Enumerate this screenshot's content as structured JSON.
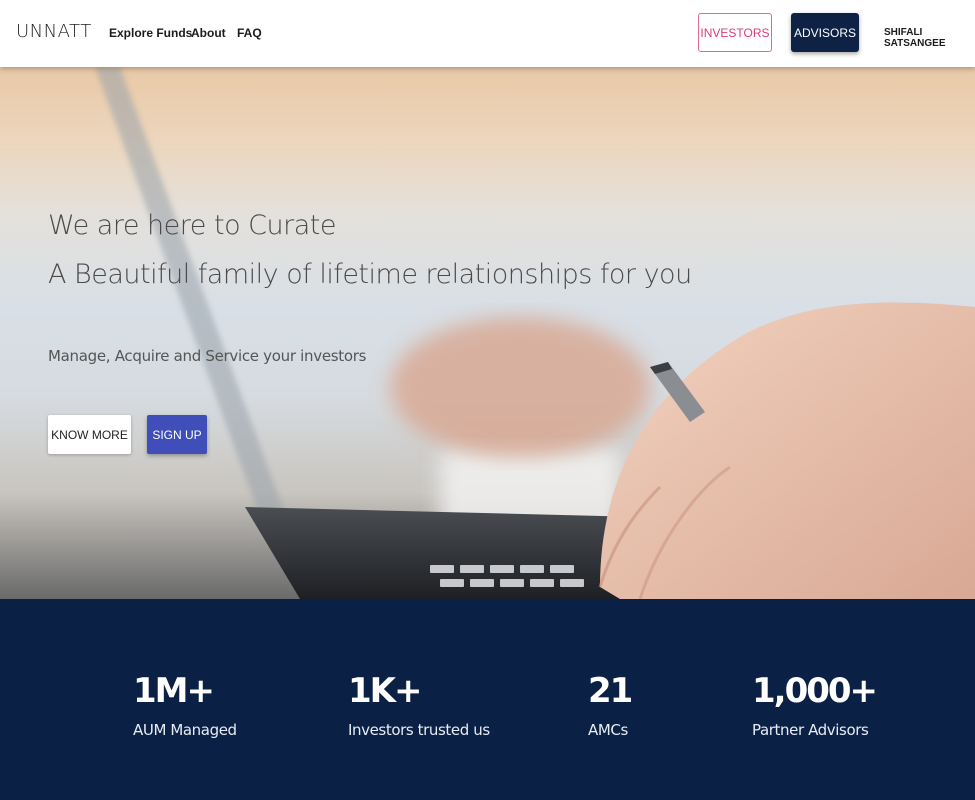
{
  "header": {
    "brand": "UNNATT",
    "nav": {
      "explore": "Explore Funds",
      "about": "About",
      "faq": "FAQ"
    },
    "investors_button": "INVESTORS",
    "advisors_button": "ADVISORS",
    "user_name": "SHIFALI SATSANGEE"
  },
  "hero": {
    "line1": "We are here to Curate",
    "line2": "A Beautiful family of lifetime relationships for you",
    "subtitle": "Manage, Acquire and Service your investors",
    "know_more": "KNOW MORE",
    "sign_up": "SIGN UP"
  },
  "stats": [
    {
      "value": "1M+",
      "label": "AUM Managed"
    },
    {
      "value": "1K+",
      "label": "Investors trusted us"
    },
    {
      "value": "21",
      "label": "AMCs"
    },
    {
      "value": "1,000+",
      "label": "Partner Advisors"
    }
  ],
  "colors": {
    "navy": "#0a2145",
    "investors_accent": "#d63d7a",
    "signup_blue": "#3f4eb8"
  }
}
